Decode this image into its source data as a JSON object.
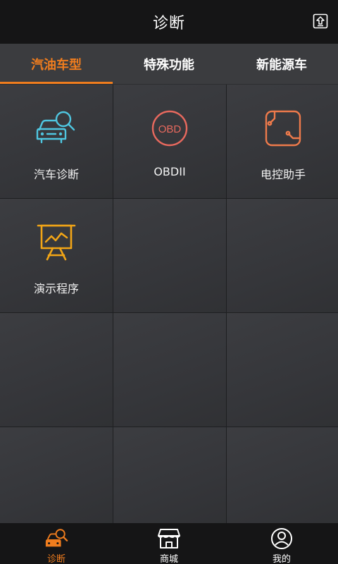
{
  "header": {
    "title": "诊断",
    "export_icon": "export-arrow-icon"
  },
  "tabs": [
    {
      "label": "汽油车型",
      "active": true
    },
    {
      "label": "特殊功能",
      "active": false
    },
    {
      "label": "新能源车",
      "active": false
    }
  ],
  "grid": {
    "items": [
      {
        "label": "汽车诊断",
        "icon": "car-search-icon",
        "color": "#4fc6e0"
      },
      {
        "label": "OBDII",
        "icon": "obd-icon",
        "icon_text": "OBD",
        "color": "#e8695e"
      },
      {
        "label": "电控助手",
        "icon": "ecu-assistant-icon",
        "color": "#ee7a4b"
      },
      {
        "label": "演示程序",
        "icon": "presentation-board-icon",
        "color": "#f2a516"
      }
    ]
  },
  "bottom_nav": [
    {
      "label": "诊断",
      "icon": "car-search-icon",
      "active": true
    },
    {
      "label": "商城",
      "icon": "shop-icon",
      "active": false
    },
    {
      "label": "我的",
      "icon": "user-icon",
      "active": false
    }
  ],
  "colors": {
    "accent": "#f07d1e",
    "header_bg": "#151516",
    "tab_bg": "#3b3c3f"
  }
}
